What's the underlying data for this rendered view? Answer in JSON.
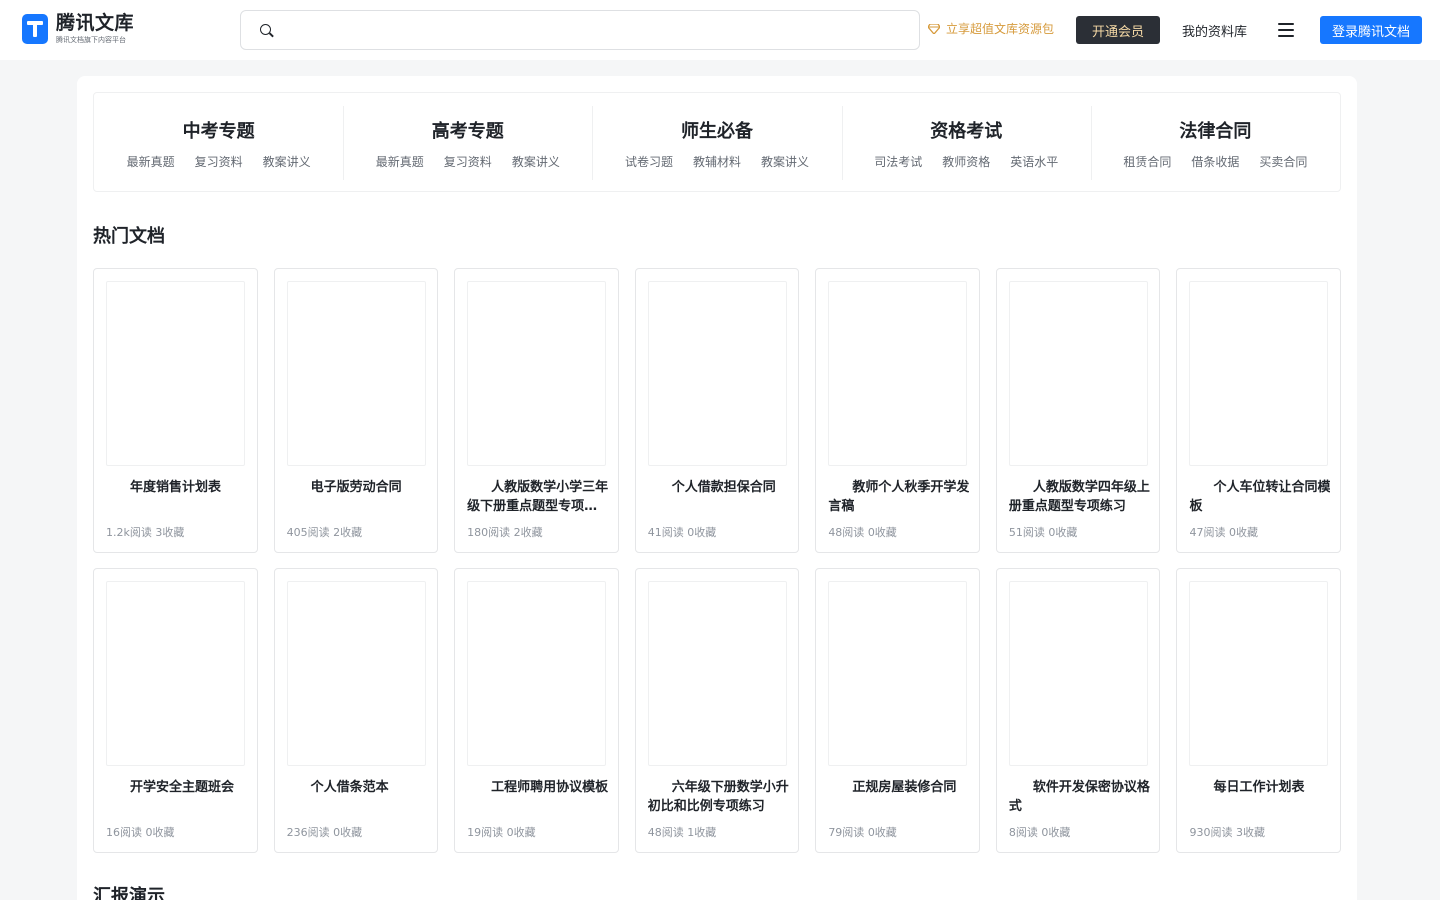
{
  "header": {
    "logo": {
      "name": "腾讯文库",
      "subtitle": "腾讯文档旗下内容平台"
    },
    "search": {
      "placeholder": "",
      "value": ""
    },
    "promo_text": "立享超值文库资源包",
    "vip_button": "开通会员",
    "library_link": "我的资料库",
    "login_button": "登录腾讯文档"
  },
  "topics": [
    {
      "title": "中考专题",
      "links": [
        "最新真题",
        "复习资料",
        "教案讲义"
      ]
    },
    {
      "title": "高考专题",
      "links": [
        "最新真题",
        "复习资料",
        "教案讲义"
      ]
    },
    {
      "title": "师生必备",
      "links": [
        "试卷习题",
        "教辅材料",
        "教案讲义"
      ]
    },
    {
      "title": "资格考试",
      "links": [
        "司法考试",
        "教师资格",
        "英语水平"
      ]
    },
    {
      "title": "法律合同",
      "links": [
        "租赁合同",
        "借条收据",
        "买卖合同"
      ]
    }
  ],
  "sections": [
    {
      "title": "热门文档",
      "rows": [
        [
          {
            "title": "年度销售计划表",
            "reads": "1.2k阅读",
            "favs": "3收藏"
          },
          {
            "title": "电子版劳动合同",
            "reads": "405阅读",
            "favs": "2收藏"
          },
          {
            "title": "人教版数学小学三年级下册重点题型专项练习",
            "reads": "180阅读",
            "favs": "2收藏"
          },
          {
            "title": "个人借款担保合同",
            "reads": "41阅读",
            "favs": "0收藏"
          },
          {
            "title": "教师个人秋季开学发言稿",
            "reads": "48阅读",
            "favs": "0收藏"
          },
          {
            "title": "人教版数学四年级上册重点题型专项练习",
            "reads": "51阅读",
            "favs": "0收藏"
          },
          {
            "title": "个人车位转让合同模板",
            "reads": "47阅读",
            "favs": "0收藏"
          }
        ],
        [
          {
            "title": "开学安全主题班会",
            "reads": "16阅读",
            "favs": "0收藏"
          },
          {
            "title": "个人借条范本",
            "reads": "236阅读",
            "favs": "0收藏"
          },
          {
            "title": "工程师聘用协议模板",
            "reads": "19阅读",
            "favs": "0收藏"
          },
          {
            "title": "六年级下册数学小升初比和比例专项练习",
            "reads": "48阅读",
            "favs": "1收藏"
          },
          {
            "title": "正规房屋装修合同",
            "reads": "79阅读",
            "favs": "0收藏"
          },
          {
            "title": "软件开发保密协议格式",
            "reads": "8阅读",
            "favs": "0收藏"
          },
          {
            "title": "每日工作计划表",
            "reads": "930阅读",
            "favs": "3收藏"
          }
        ]
      ]
    },
    {
      "title": "汇报演示"
    }
  ]
}
